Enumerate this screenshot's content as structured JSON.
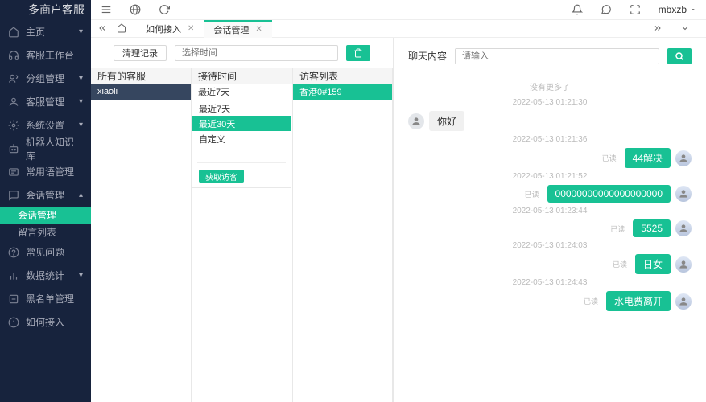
{
  "sidebar": {
    "title": "多商户客服",
    "items": [
      {
        "label": "主页",
        "icon": "home",
        "expandable": true
      },
      {
        "label": "客服工作台",
        "icon": "headset"
      },
      {
        "label": "分组管理",
        "icon": "group",
        "expandable": true
      },
      {
        "label": "客服管理",
        "icon": "user",
        "expandable": true
      },
      {
        "label": "系统设置",
        "icon": "gear",
        "expandable": true
      },
      {
        "label": "机器人知识库",
        "icon": "robot"
      },
      {
        "label": "常用语管理",
        "icon": "phrase"
      },
      {
        "label": "会话管理",
        "icon": "chat",
        "expandable": true,
        "expanded": true,
        "children": [
          {
            "label": "会话管理",
            "active": true
          },
          {
            "label": "留言列表"
          }
        ]
      },
      {
        "label": "常见问题",
        "icon": "faq"
      },
      {
        "label": "数据统计",
        "icon": "stats",
        "expandable": true
      },
      {
        "label": "黑名单管理",
        "icon": "blacklist"
      },
      {
        "label": "如何接入",
        "icon": "howto"
      }
    ]
  },
  "topbar": {
    "user": "mbxzb"
  },
  "tabs": [
    {
      "label": "如何接入",
      "active": false
    },
    {
      "label": "会话管理",
      "active": true
    }
  ],
  "filter": {
    "clear_btn": "清理记录",
    "time_placeholder": "选择时间",
    "headers": [
      "所有的客服",
      "接待时间",
      "访客列表"
    ],
    "agents": [
      {
        "label": "xiaoli",
        "selected": true
      }
    ],
    "time_options": [
      {
        "label": "最近7天"
      },
      {
        "label": "最近30天",
        "active": true
      },
      {
        "label": "自定义"
      }
    ],
    "get_visitors_btn": "获取访客",
    "visitors": [
      {
        "label": "香港0#159",
        "selected": true
      }
    ]
  },
  "chat": {
    "title": "聊天内容",
    "search_placeholder": "请输入",
    "no_more": "没有更多了",
    "read_label": "已读",
    "messages": [
      {
        "ts": "2022-05-13 01:21:30"
      },
      {
        "side": "left",
        "text": "你好"
      },
      {
        "ts": "2022-05-13 01:21:36"
      },
      {
        "side": "right",
        "text": "44解决",
        "read": true
      },
      {
        "ts": "2022-05-13 01:21:52"
      },
      {
        "side": "right",
        "text": "00000000000000000000",
        "read": true
      },
      {
        "ts": "2022-05-13 01:23:44"
      },
      {
        "side": "right",
        "text": "5525",
        "read": true
      },
      {
        "ts": "2022-05-13 01:24:03"
      },
      {
        "side": "right",
        "text": "日女",
        "read": true
      },
      {
        "ts": "2022-05-13 01:24:43"
      },
      {
        "side": "right",
        "text": "水电费离开",
        "read": true
      }
    ]
  }
}
